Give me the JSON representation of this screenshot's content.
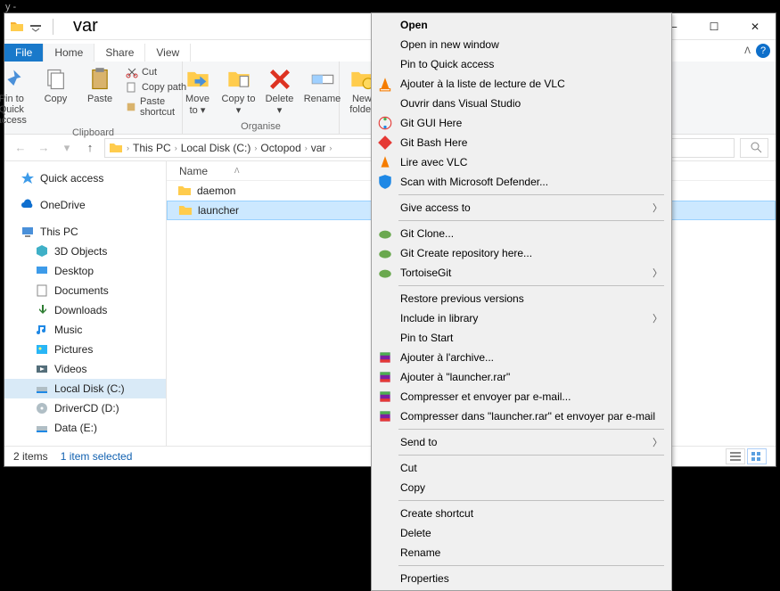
{
  "outer_title": "y -",
  "window_title": "var",
  "tabs": {
    "file": "File",
    "home": "Home",
    "share": "Share",
    "view": "View"
  },
  "ribbon": {
    "pin": "Pin to Quick access",
    "copy": "Copy",
    "paste": "Paste",
    "cut": "Cut",
    "copy_path": "Copy path",
    "paste_shortcut": "Paste shortcut",
    "clipboard": "Clipboard",
    "move_to": "Move to ▾",
    "copy_to": "Copy to ▾",
    "delete": "Delete ▾",
    "rename": "Rename",
    "organise": "Organise",
    "new_folder": "New folder"
  },
  "breadcrumb": [
    "This PC",
    "Local Disk (C:)",
    "Octopod",
    "var"
  ],
  "columns": {
    "name": "Name"
  },
  "rows": [
    {
      "name": "daemon",
      "selected": false
    },
    {
      "name": "launcher",
      "selected": true
    }
  ],
  "tree": {
    "quick": "Quick access",
    "onedrive": "OneDrive",
    "thispc": "This PC",
    "obj3d": "3D Objects",
    "desktop": "Desktop",
    "documents": "Documents",
    "downloads": "Downloads",
    "music": "Music",
    "pictures": "Pictures",
    "videos": "Videos",
    "diskc": "Local Disk (C:)",
    "driverd": "DriverCD (D:)",
    "datae": "Data (E:)"
  },
  "status": {
    "items": "2 items",
    "selected": "1 item selected"
  },
  "ctx": {
    "open": "Open",
    "open_new": "Open in new window",
    "pin_quick": "Pin to Quick access",
    "vlc_add": "Ajouter à la liste de lecture de VLC",
    "vs_open": "Ouvrir dans Visual Studio",
    "git_gui": "Git GUI Here",
    "git_bash": "Git Bash Here",
    "vlc_play": "Lire avec VLC",
    "defender": "Scan with Microsoft Defender...",
    "give_access": "Give access to",
    "git_clone": "Git Clone...",
    "git_create": "Git Create repository here...",
    "tortoise": "TortoiseGit",
    "restore": "Restore previous versions",
    "include": "Include in library",
    "pin_start": "Pin to Start",
    "rar_add": "Ajouter à l'archive...",
    "rar_add2": "Ajouter à \"launcher.rar\"",
    "rar_mail": "Compresser et envoyer par e-mail...",
    "rar_mail2": "Compresser dans \"launcher.rar\" et envoyer par e-mail",
    "send_to": "Send to",
    "cut": "Cut",
    "copy": "Copy",
    "shortcut": "Create shortcut",
    "delete": "Delete",
    "rename": "Rename",
    "props": "Properties"
  }
}
